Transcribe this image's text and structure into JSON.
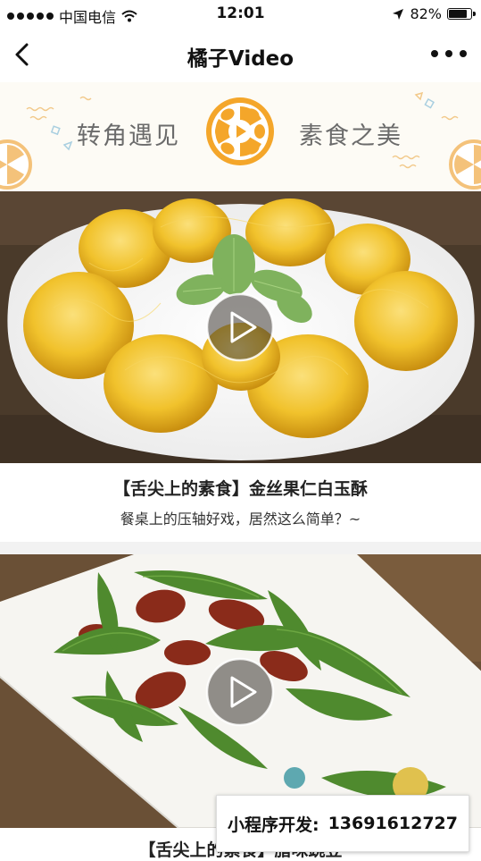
{
  "status_bar": {
    "carrier": "中国电信",
    "time": "12:01",
    "battery": "82%",
    "battery_level": 0.82
  },
  "nav": {
    "title": "橘子Video"
  },
  "banner": {
    "left_text": "转角遇见",
    "right_text": "素食之美",
    "accent_color": "#f4a62a"
  },
  "videos": [
    {
      "title": "【舌尖上的素食】金丝果仁白玉酥",
      "description": "餐桌上的压轴好戏，居然这么简单？~"
    },
    {
      "title": "【舌尖上的素食】腊味豌豆"
    }
  ],
  "contact": {
    "label": "小程序开发:",
    "phone": "13691612727"
  }
}
